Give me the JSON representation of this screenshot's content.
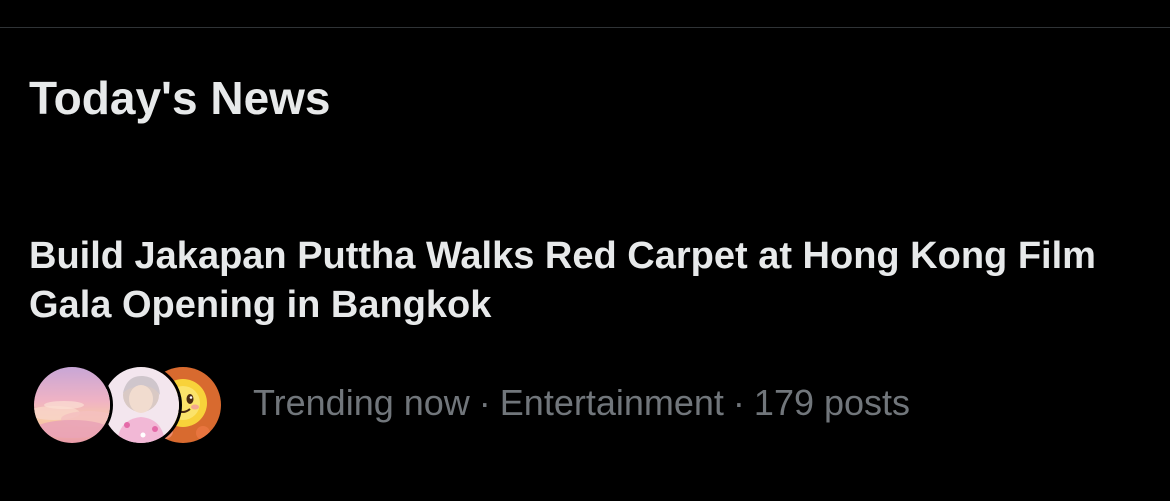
{
  "section": {
    "title": "Today's News"
  },
  "news_item": {
    "headline": "Build Jakapan Puttha Walks Red Carpet at Hong Kong Film Gala Opening in Bangkok",
    "meta": {
      "trend_label": "Trending now",
      "separator": "·",
      "category": "Entertainment",
      "post_count": "179 posts"
    },
    "avatars": [
      {
        "name": "pink-clouds-avatar"
      },
      {
        "name": "person-photo-avatar"
      },
      {
        "name": "sun-emoji-avatar"
      }
    ]
  },
  "colors": {
    "background": "#000000",
    "primary_text": "#e7e9ea",
    "secondary_text": "#71767b",
    "divider": "#2f3336"
  }
}
